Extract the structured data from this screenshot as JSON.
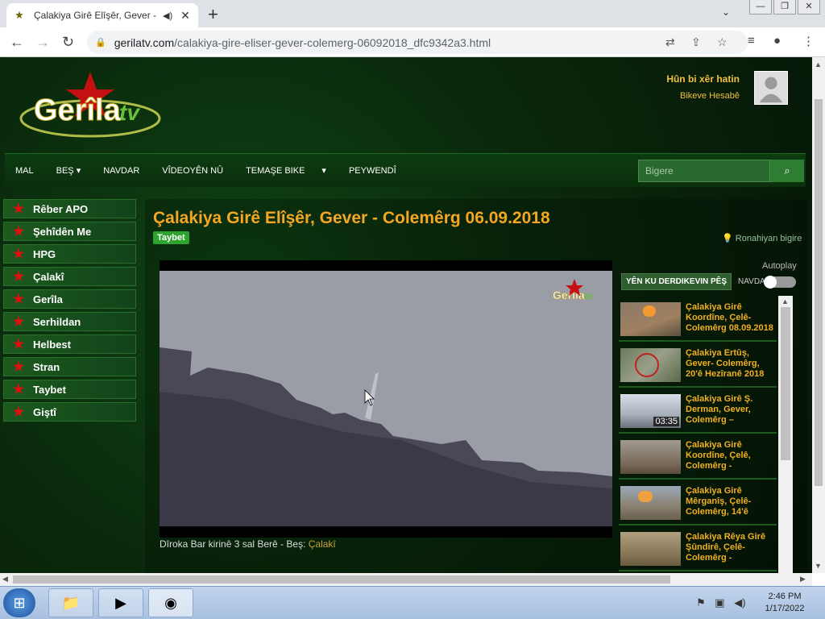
{
  "browser": {
    "tab_title": "Çalakiya Girê Elîşêr, Gever - C",
    "url_host": "gerilatv.com",
    "url_path": "/calakiya-gire-eliser-gever-colemerg-06092018_dfc9342a3.html"
  },
  "header": {
    "logo_text": "Gerîla",
    "logo_tv": "tv",
    "guest_label": "Hûn bi xêr hatin",
    "account_link": "Bikeve Hesabê"
  },
  "menu": {
    "items": [
      "MAL",
      "BEŞ",
      "NAVDAR",
      "VÎDEOYÊN NÛ",
      "TEMAŞE BIKE",
      "",
      "PEYWENDÎ"
    ],
    "search_placeholder": "Bigere"
  },
  "sidebar": {
    "items": [
      "Rêber APO",
      "Şehîdên Me",
      "HPG",
      "Çalakî",
      "Gerîla",
      "Serhildan",
      "Helbest",
      "Stran",
      "Taybet",
      "Giştî"
    ]
  },
  "main": {
    "title": "Çalakiya Girê Elîşêr, Gever - Colemêrg 06.09.2018",
    "tag": "Taybet",
    "views_label": "Ronahiyan bigire",
    "caption_prefix": "Dîroka Bar kirinê 3 sal Berê - Beş:",
    "caption_link": "Çalakî",
    "watermark_text": "Gerîla",
    "watermark_tv": "tv"
  },
  "related": {
    "autoplay_label": "Autoplay",
    "next_label": "YÊN KU DERDIKEVIN PÊŞ",
    "navda_label": "NAVDA",
    "items": [
      {
        "title": "Çalakiya Girê Koordîne, Çelê-Colemêrg 08.09.2018",
        "duration": ""
      },
      {
        "title": "Çalakiya Ertûş, Gever- Colemêrg, 20'ê Hezîranê 2018",
        "duration": ""
      },
      {
        "title": "Çalakiya Girê Ş. Derman, Gever, Colemêrg –",
        "duration": "03:35"
      },
      {
        "title": "Çalakiya Girê Koordîne, Çelê, Colemêrg -",
        "duration": ""
      },
      {
        "title": "Çalakiya Girê Mêrganîş, Çelê-Colemêrg, 14'ê",
        "duration": ""
      },
      {
        "title": "Çalakiya Rêya Girê Şûndirê, Çelê-Colemêrg -",
        "duration": ""
      }
    ]
  },
  "taskbar": {
    "time": "2:46 PM",
    "date": "1/17/2022"
  },
  "colors": {
    "accent": "#f5a623",
    "page_bg": "#0a2a0c",
    "star": "#e01010"
  }
}
